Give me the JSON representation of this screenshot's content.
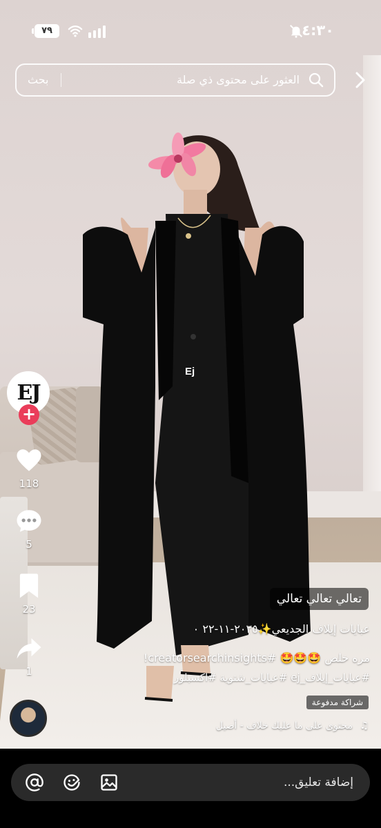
{
  "status_bar": {
    "battery": "٧٩",
    "time": "٤:٣٠",
    "icons": [
      "battery-icon",
      "wifi-icon",
      "signal-icon",
      "mute-icon"
    ]
  },
  "search": {
    "button_label": "بحث",
    "placeholder": "العثور على محتوى ذي صلة"
  },
  "video": {
    "brand_text": "Ej"
  },
  "profile": {
    "avatar_text": "EJ",
    "follow_symbol": "+"
  },
  "actions": {
    "likes": "118",
    "comments": "5",
    "saves": "23",
    "shares": "1"
  },
  "caption": {
    "overlay_text": "تعالي تعالي تعالي",
    "line1": "عبايات إيلاف الجديعي✨٢٠٢٥-١١-٢٢ ٠",
    "line2": "مره خلص 🤩🤩🤩 #creatorsearchinsights!",
    "line3": "#عبايات_إيلاف_ej #عبايات_شتوية #اكسبلور",
    "ad_label": "شراكة مدفوعة",
    "music": "محتوى على ما عليك خلاف - أصيل"
  },
  "comment_bar": {
    "placeholder": "إضافة تعليق..."
  },
  "colors": {
    "follow_red": "#ea3d5a",
    "comment_bg": "#2a2a2a"
  }
}
